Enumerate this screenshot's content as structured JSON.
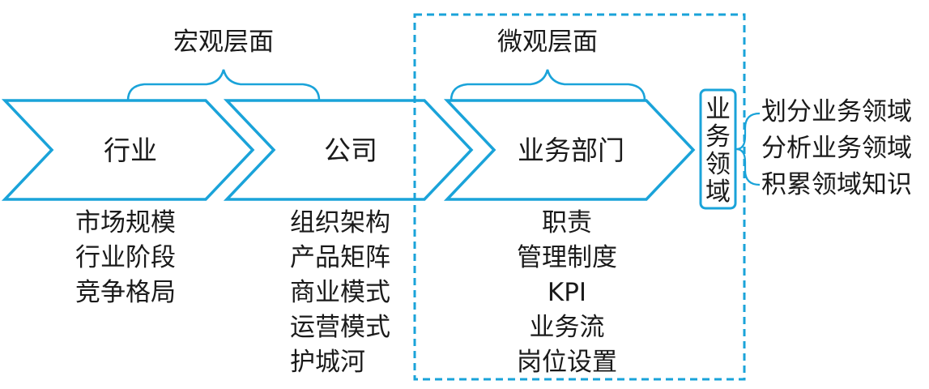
{
  "groups": {
    "macro": "宏观层面",
    "micro": "微观层面"
  },
  "stages": [
    {
      "label": "行业",
      "items": [
        "市场规模",
        "行业阶段",
        "竞争格局"
      ]
    },
    {
      "label": "公司",
      "items": [
        "组织架构",
        "产品矩阵",
        "商业模式",
        "运营模式",
        "护城河"
      ]
    },
    {
      "label": "业务部门",
      "items": [
        "职责",
        "管理制度",
        "KPI",
        "业务流",
        "岗位设置"
      ]
    }
  ],
  "domain": {
    "chars": [
      "业",
      "务",
      "领",
      "域"
    ],
    "tasks": [
      "划分业务领域",
      "分析业务领域",
      "积累领域知识"
    ]
  },
  "colors": {
    "accent": "#1aa3d9",
    "text": "#1a1a1a"
  }
}
